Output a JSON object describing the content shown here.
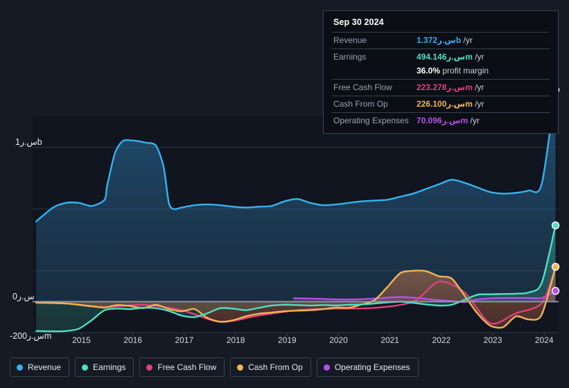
{
  "chart_data": {
    "type": "area",
    "title": "",
    "xlabel": "",
    "ylabel": "",
    "currency_symbol": "س.ر",
    "grid": true,
    "legend_position": "bottom-left",
    "xlim": [
      2014.55,
      2024.78
    ],
    "ylim": [
      -200000000,
      1200000000
    ],
    "y_ticks": [
      {
        "value": 1000000000,
        "label": "1س.رb"
      },
      {
        "value": 0,
        "label": "0س.ر"
      },
      {
        "value": -200000000,
        "label": "-200س.رm"
      }
    ],
    "x_ticks": [
      "2015",
      "2016",
      "2017",
      "2018",
      "2019",
      "2020",
      "2021",
      "2022",
      "2023",
      "2024"
    ],
    "series": [
      {
        "name": "Revenue",
        "color": "#35b3ef",
        "filled": true,
        "x": [
          2014.62,
          2014.95,
          2015.2,
          2015.45,
          2015.7,
          2015.95,
          2016.0,
          2016.15,
          2016.3,
          2016.45,
          2016.6,
          2016.75,
          2016.95,
          2017.1,
          2017.2,
          2017.3,
          2017.45,
          2017.7,
          2017.95,
          2018.2,
          2018.45,
          2018.7,
          2018.95,
          2019.2,
          2019.45,
          2019.7,
          2019.95,
          2020.2,
          2020.45,
          2020.7,
          2020.95,
          2021.2,
          2021.45,
          2021.7,
          2021.95,
          2022.2,
          2022.45,
          2022.7,
          2022.95,
          2023.2,
          2023.45,
          2023.7,
          2023.95,
          2024.2,
          2024.45,
          2024.72
        ],
        "values": [
          520,
          610,
          640,
          640,
          620,
          660,
          750,
          960,
          1040,
          1045,
          1040,
          1030,
          1010,
          870,
          640,
          600,
          610,
          625,
          630,
          625,
          615,
          610,
          615,
          620,
          650,
          665,
          640,
          625,
          630,
          640,
          650,
          655,
          660,
          680,
          700,
          730,
          760,
          790,
          770,
          740,
          710,
          700,
          705,
          720,
          760,
          1372
        ],
        "value_unit": "million"
      },
      {
        "name": "Earnings",
        "color": "#4fdfc4",
        "filled": true,
        "x": [
          2014.62,
          2014.95,
          2015.2,
          2015.45,
          2015.7,
          2015.95,
          2016.2,
          2016.45,
          2016.7,
          2016.95,
          2017.2,
          2017.45,
          2017.7,
          2017.95,
          2018.2,
          2018.45,
          2018.7,
          2018.95,
          2019.2,
          2019.45,
          2019.7,
          2019.95,
          2020.2,
          2020.45,
          2020.7,
          2020.95,
          2021.2,
          2021.45,
          2021.7,
          2021.95,
          2022.2,
          2022.45,
          2022.7,
          2022.95,
          2023.2,
          2023.45,
          2023.7,
          2023.95,
          2024.2,
          2024.45,
          2024.72
        ],
        "values": [
          -190,
          -192,
          -190,
          -175,
          -120,
          -55,
          -45,
          -48,
          -40,
          -42,
          -60,
          -90,
          -100,
          -75,
          -42,
          -45,
          -55,
          -40,
          -25,
          -20,
          -22,
          -25,
          -22,
          -24,
          -20,
          -18,
          -12,
          -5,
          0,
          -8,
          -18,
          -25,
          -20,
          12,
          45,
          48,
          50,
          52,
          60,
          120,
          494.146
        ],
        "value_unit": "million"
      },
      {
        "name": "Free Cash Flow",
        "color": "#e0407c",
        "filled": false,
        "x": [
          2014.62,
          2015.2,
          2015.95,
          2016.7,
          2017.45,
          2018.2,
          2018.95,
          2019.7,
          2020.45,
          2021.2,
          2021.95,
          2022.45,
          2022.95,
          2023.45,
          2023.95,
          2024.45,
          2024.72
        ],
        "values": [
          -8,
          -12,
          -35,
          -20,
          -55,
          -130,
          -90,
          -55,
          -45,
          -40,
          0,
          130,
          60,
          -140,
          -75,
          -10,
          223.278
        ],
        "value_unit": "million"
      },
      {
        "name": "Cash From Op",
        "color": "#f0b455",
        "filled": true,
        "x": [
          2014.62,
          2014.95,
          2015.2,
          2015.45,
          2015.7,
          2015.95,
          2016.2,
          2016.45,
          2016.7,
          2016.95,
          2017.2,
          2017.45,
          2017.7,
          2017.95,
          2018.2,
          2018.45,
          2018.7,
          2018.95,
          2019.2,
          2019.45,
          2019.7,
          2019.95,
          2020.2,
          2020.45,
          2020.7,
          2020.95,
          2021.2,
          2021.45,
          2021.7,
          2021.95,
          2022.2,
          2022.45,
          2022.7,
          2022.95,
          2023.2,
          2023.45,
          2023.7,
          2023.95,
          2024.2,
          2024.45,
          2024.72
        ],
        "values": [
          -5,
          -8,
          -12,
          -20,
          -30,
          -38,
          -22,
          -28,
          -42,
          -20,
          -48,
          -62,
          -48,
          -105,
          -130,
          -120,
          -95,
          -78,
          -70,
          -62,
          -58,
          -55,
          -48,
          -38,
          -40,
          -18,
          10,
          95,
          185,
          200,
          198,
          165,
          150,
          40,
          -75,
          -155,
          -165,
          -95,
          -115,
          -85,
          226.1
        ],
        "value_unit": "million"
      },
      {
        "name": "Operating Expenses",
        "color": "#b84fe8",
        "filled": true,
        "x": [
          2019.63,
          2019.95,
          2020.2,
          2020.45,
          2020.7,
          2020.95,
          2021.2,
          2021.45,
          2021.7,
          2021.95,
          2022.2,
          2022.45,
          2022.7,
          2022.95,
          2023.2,
          2023.45,
          2023.7,
          2023.95,
          2024.2,
          2024.45,
          2024.72
        ],
        "values": [
          22,
          20,
          18,
          15,
          14,
          16,
          20,
          26,
          30,
          26,
          18,
          10,
          4,
          -2,
          14,
          22,
          24,
          24,
          24,
          24,
          70.096
        ],
        "value_unit": "million"
      }
    ]
  },
  "tooltip": {
    "date": "Sep 30 2024",
    "rows": [
      {
        "label": "Revenue",
        "value": "1.372س.رb",
        "unit": "/yr",
        "color": "#3ea9f5"
      },
      {
        "label": "Earnings",
        "value": "494.146س.رm",
        "unit": "/yr",
        "color": "#4fdfc4"
      },
      {
        "label": "Free Cash Flow",
        "value": "223.278س.رm",
        "unit": "/yr",
        "color": "#e0407c"
      },
      {
        "label": "Cash From Op",
        "value": "226.100س.رm",
        "unit": "/yr",
        "color": "#f0b455"
      },
      {
        "label": "Operating Expenses",
        "value": "70.096س.رm",
        "unit": "/yr",
        "color": "#b84fe8"
      }
    ],
    "profit_margin_value": "36.0%",
    "profit_margin_label": "profit margin"
  },
  "legend": {
    "items": [
      {
        "label": "Revenue",
        "color": "#35b3ef"
      },
      {
        "label": "Earnings",
        "color": "#4fdfc4"
      },
      {
        "label": "Free Cash Flow",
        "color": "#e0407c"
      },
      {
        "label": "Cash From Op",
        "color": "#f0b455"
      },
      {
        "label": "Operating Expenses",
        "color": "#b84fe8"
      }
    ]
  }
}
